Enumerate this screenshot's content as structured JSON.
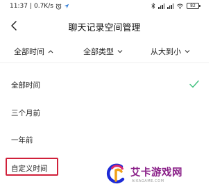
{
  "status_bar": {
    "time": "11:37",
    "network_speed": "0.7K/s",
    "battery": "82"
  },
  "header": {
    "title": "聊天记录空间管理"
  },
  "filters": [
    {
      "label": "全部时间",
      "arrow": "up"
    },
    {
      "label": "全部类型",
      "arrow": "down"
    },
    {
      "label": "从大到小",
      "arrow": "down"
    }
  ],
  "options": [
    {
      "label": "全部时间",
      "selected": true
    },
    {
      "label": "三个月前",
      "selected": false
    },
    {
      "label": "一年前",
      "selected": false
    },
    {
      "label": "自定义时间",
      "selected": false,
      "highlighted": true
    }
  ],
  "watermark": {
    "text": "艾卡游戏网",
    "subtext": "AIKAGAME.COM"
  },
  "colors": {
    "check": "#3dbf7c",
    "highlight_box": "#d0203a",
    "watermark": "#8a1f88"
  }
}
